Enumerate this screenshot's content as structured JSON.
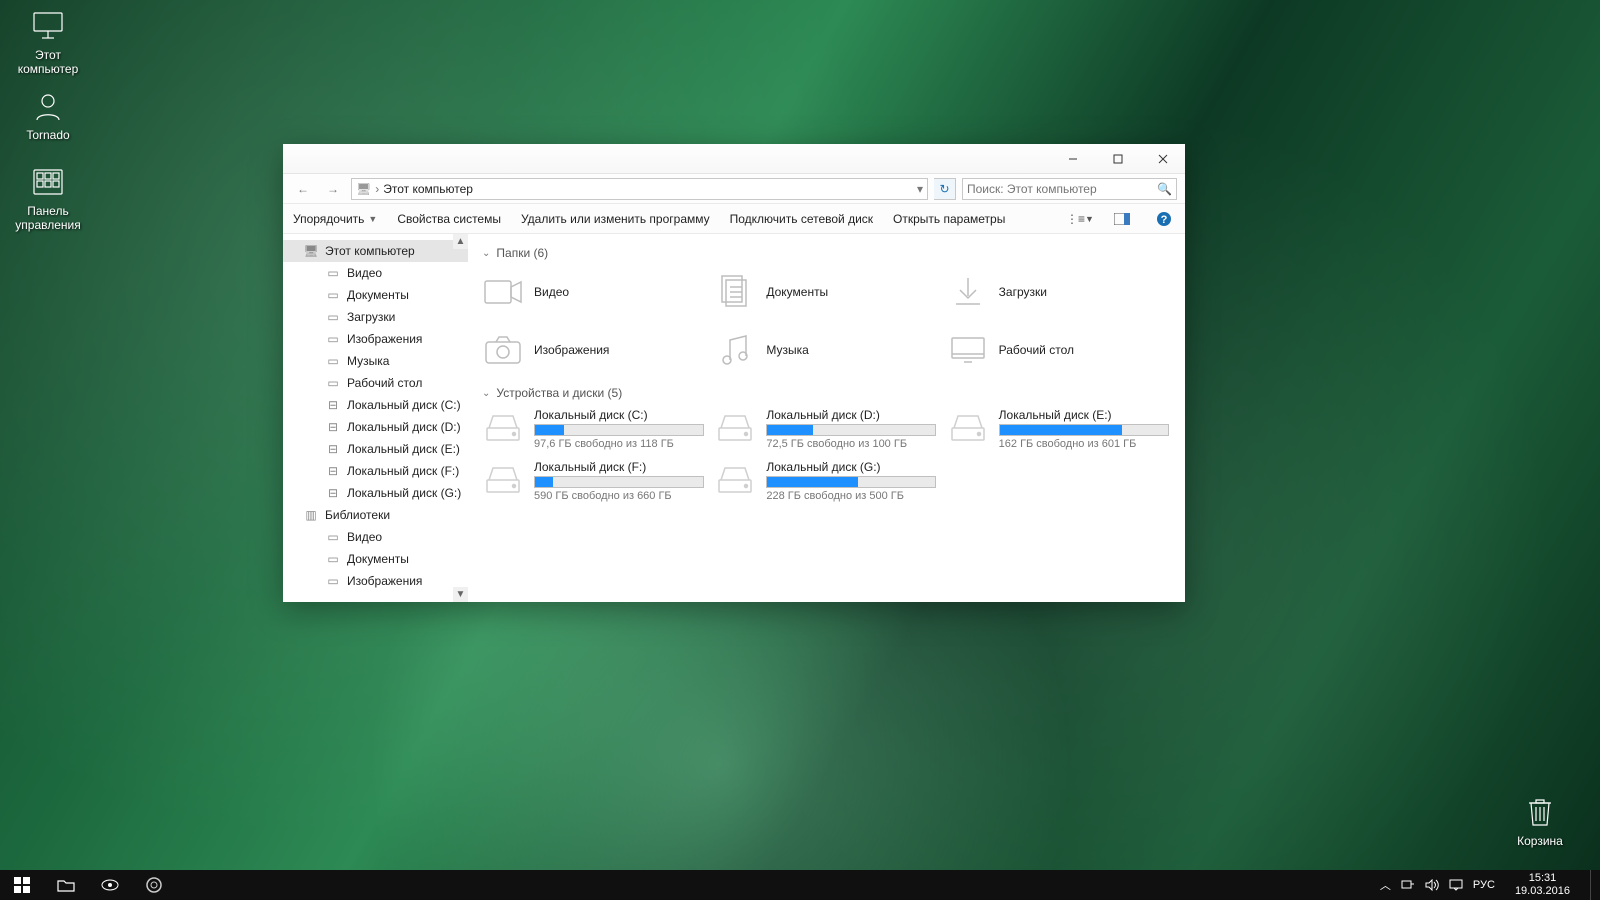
{
  "desktop_icons": {
    "this_pc": "Этот компьютер",
    "tornado": "Tornado",
    "control_panel_l1": "Панель",
    "control_panel_l2": "управления",
    "recycle_bin": "Корзина"
  },
  "window": {
    "breadcrumb": "Этот компьютер",
    "search_placeholder": "Поиск: Этот компьютер",
    "toolbar": {
      "organize": "Упорядочить",
      "system_properties": "Свойства системы",
      "uninstall": "Удалить или изменить программу",
      "map_drive": "Подключить сетевой диск",
      "open_settings": "Открыть параметры"
    },
    "nav": {
      "this_pc": "Этот компьютер",
      "video": "Видео",
      "documents": "Документы",
      "downloads": "Загрузки",
      "pictures": "Изображения",
      "music": "Музыка",
      "desktop": "Рабочий стол",
      "disk_c": "Локальный диск (C:)",
      "disk_d": "Локальный диск (D:)",
      "disk_e": "Локальный диск (E:)",
      "disk_f": "Локальный диск (F:)",
      "disk_g": "Локальный диск (G:)",
      "libraries": "Библиотеки",
      "lib_video": "Видео",
      "lib_documents": "Документы",
      "lib_pictures": "Изображения"
    },
    "sections": {
      "folders": "Папки (6)",
      "drives": "Устройства и диски (5)"
    },
    "folders": {
      "video": "Видео",
      "documents": "Документы",
      "downloads": "Загрузки",
      "pictures": "Изображения",
      "music": "Музыка",
      "desktop": "Рабочий стол"
    },
    "drives": [
      {
        "name": "Локальный диск (C:)",
        "free": "97,6 ГБ свободно из 118 ГБ",
        "used_pct": 17
      },
      {
        "name": "Локальный диск (D:)",
        "free": "72,5 ГБ свободно из 100 ГБ",
        "used_pct": 27
      },
      {
        "name": "Локальный диск (E:)",
        "free": "162 ГБ свободно из 601 ГБ",
        "used_pct": 73
      },
      {
        "name": "Локальный диск (F:)",
        "free": "590 ГБ свободно из 660 ГБ",
        "used_pct": 11
      },
      {
        "name": "Локальный диск (G:)",
        "free": "228 ГБ свободно из 500 ГБ",
        "used_pct": 54
      }
    ]
  },
  "taskbar": {
    "lang": "РУС",
    "time": "15:31",
    "date": "19.03.2016"
  }
}
